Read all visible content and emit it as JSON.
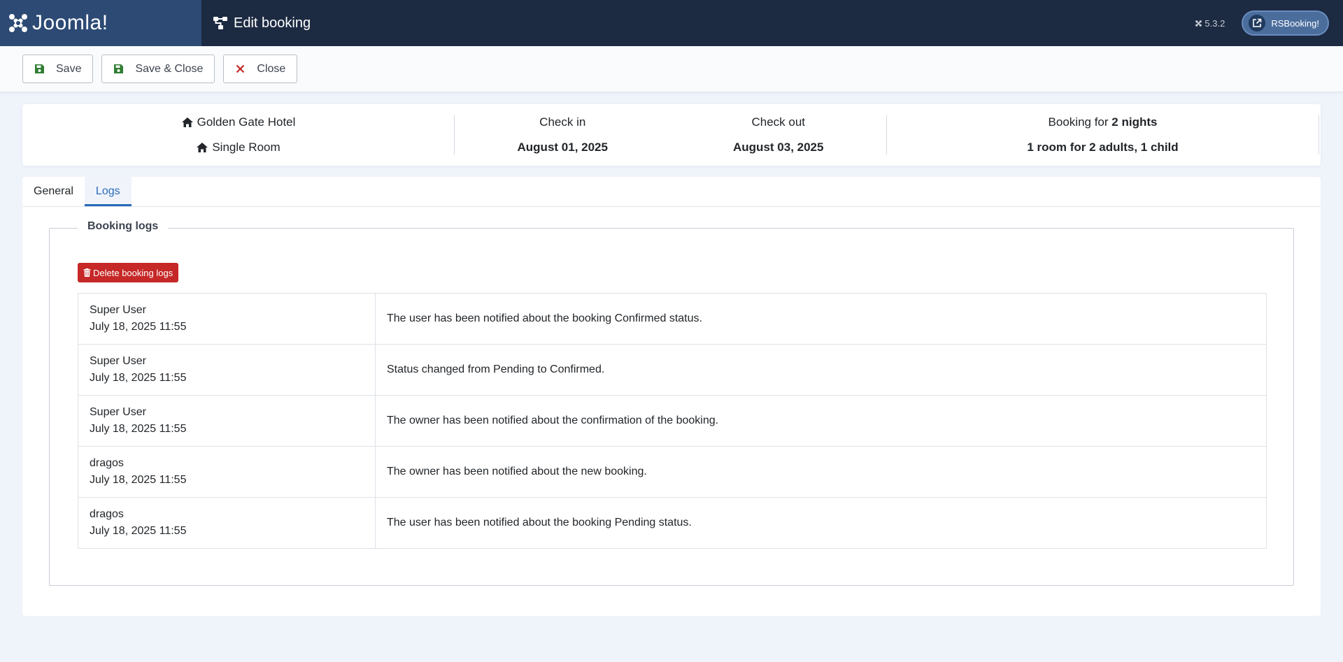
{
  "header": {
    "logo_text": "Joomla!",
    "page_title": "Edit booking",
    "version": "5.3.2",
    "external_link_label": "RSBooking!"
  },
  "toolbar": {
    "save_label": "Save",
    "save_close_label": "Save & Close",
    "close_label": "Close"
  },
  "summary": {
    "hotel": "Golden Gate Hotel",
    "room": "Single Room",
    "check_in_label": "Check in",
    "check_in_date": "August 01, 2025",
    "check_out_label": "Check out",
    "check_out_date": "August 03, 2025",
    "booking_for_prefix": "Booking for",
    "nights": "2 nights",
    "occupancy": "1 room for 2 adults, 1 child"
  },
  "tabs": [
    {
      "label": "General",
      "active": false
    },
    {
      "label": "Logs",
      "active": true
    }
  ],
  "logs": {
    "legend": "Booking logs",
    "delete_label": "Delete booking logs",
    "rows": [
      {
        "user": "Super User",
        "date": "July 18, 2025 11:55",
        "message": "The user has been notified about the booking Confirmed status."
      },
      {
        "user": "Super User",
        "date": "July 18, 2025 11:55",
        "message": "Status changed from Pending to Confirmed."
      },
      {
        "user": "Super User",
        "date": "July 18, 2025 11:55",
        "message": "The owner has been notified about the confirmation of the booking."
      },
      {
        "user": "dragos",
        "date": "July 18, 2025 11:55",
        "message": "The owner has been notified about the new booking."
      },
      {
        "user": "dragos",
        "date": "July 18, 2025 11:55",
        "message": "The user has been notified about the booking Pending status."
      }
    ]
  },
  "colors": {
    "header_bg": "#1c2a42",
    "brand_bg": "#2c4a74",
    "accent": "#2a69b8",
    "danger": "#c52827",
    "save_icon": "#2f7d32",
    "close_icon": "#c52827"
  },
  "icons": {
    "logo": "joomla-logo-icon",
    "title": "workflow-icon",
    "version": "joomla-small-icon",
    "external": "external-link-icon",
    "save": "floppy-disk-icon",
    "close": "close-icon",
    "hotel": "home-icon",
    "room": "home-icon",
    "delete": "trash-icon"
  }
}
